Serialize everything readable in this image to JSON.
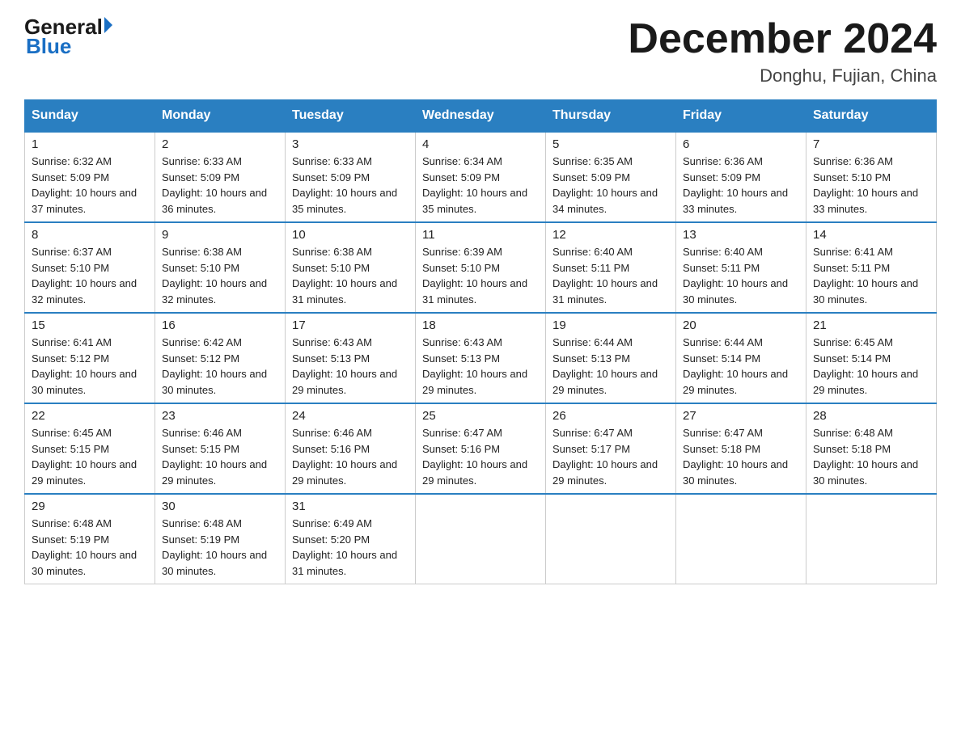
{
  "logo": {
    "general": "General",
    "triangle": "▶",
    "blue": "Blue"
  },
  "title": "December 2024",
  "location": "Donghu, Fujian, China",
  "days_of_week": [
    "Sunday",
    "Monday",
    "Tuesday",
    "Wednesday",
    "Thursday",
    "Friday",
    "Saturday"
  ],
  "weeks": [
    [
      {
        "day": "1",
        "sunrise": "Sunrise: 6:32 AM",
        "sunset": "Sunset: 5:09 PM",
        "daylight": "Daylight: 10 hours and 37 minutes."
      },
      {
        "day": "2",
        "sunrise": "Sunrise: 6:33 AM",
        "sunset": "Sunset: 5:09 PM",
        "daylight": "Daylight: 10 hours and 36 minutes."
      },
      {
        "day": "3",
        "sunrise": "Sunrise: 6:33 AM",
        "sunset": "Sunset: 5:09 PM",
        "daylight": "Daylight: 10 hours and 35 minutes."
      },
      {
        "day": "4",
        "sunrise": "Sunrise: 6:34 AM",
        "sunset": "Sunset: 5:09 PM",
        "daylight": "Daylight: 10 hours and 35 minutes."
      },
      {
        "day": "5",
        "sunrise": "Sunrise: 6:35 AM",
        "sunset": "Sunset: 5:09 PM",
        "daylight": "Daylight: 10 hours and 34 minutes."
      },
      {
        "day": "6",
        "sunrise": "Sunrise: 6:36 AM",
        "sunset": "Sunset: 5:09 PM",
        "daylight": "Daylight: 10 hours and 33 minutes."
      },
      {
        "day": "7",
        "sunrise": "Sunrise: 6:36 AM",
        "sunset": "Sunset: 5:10 PM",
        "daylight": "Daylight: 10 hours and 33 minutes."
      }
    ],
    [
      {
        "day": "8",
        "sunrise": "Sunrise: 6:37 AM",
        "sunset": "Sunset: 5:10 PM",
        "daylight": "Daylight: 10 hours and 32 minutes."
      },
      {
        "day": "9",
        "sunrise": "Sunrise: 6:38 AM",
        "sunset": "Sunset: 5:10 PM",
        "daylight": "Daylight: 10 hours and 32 minutes."
      },
      {
        "day": "10",
        "sunrise": "Sunrise: 6:38 AM",
        "sunset": "Sunset: 5:10 PM",
        "daylight": "Daylight: 10 hours and 31 minutes."
      },
      {
        "day": "11",
        "sunrise": "Sunrise: 6:39 AM",
        "sunset": "Sunset: 5:10 PM",
        "daylight": "Daylight: 10 hours and 31 minutes."
      },
      {
        "day": "12",
        "sunrise": "Sunrise: 6:40 AM",
        "sunset": "Sunset: 5:11 PM",
        "daylight": "Daylight: 10 hours and 31 minutes."
      },
      {
        "day": "13",
        "sunrise": "Sunrise: 6:40 AM",
        "sunset": "Sunset: 5:11 PM",
        "daylight": "Daylight: 10 hours and 30 minutes."
      },
      {
        "day": "14",
        "sunrise": "Sunrise: 6:41 AM",
        "sunset": "Sunset: 5:11 PM",
        "daylight": "Daylight: 10 hours and 30 minutes."
      }
    ],
    [
      {
        "day": "15",
        "sunrise": "Sunrise: 6:41 AM",
        "sunset": "Sunset: 5:12 PM",
        "daylight": "Daylight: 10 hours and 30 minutes."
      },
      {
        "day": "16",
        "sunrise": "Sunrise: 6:42 AM",
        "sunset": "Sunset: 5:12 PM",
        "daylight": "Daylight: 10 hours and 30 minutes."
      },
      {
        "day": "17",
        "sunrise": "Sunrise: 6:43 AM",
        "sunset": "Sunset: 5:13 PM",
        "daylight": "Daylight: 10 hours and 29 minutes."
      },
      {
        "day": "18",
        "sunrise": "Sunrise: 6:43 AM",
        "sunset": "Sunset: 5:13 PM",
        "daylight": "Daylight: 10 hours and 29 minutes."
      },
      {
        "day": "19",
        "sunrise": "Sunrise: 6:44 AM",
        "sunset": "Sunset: 5:13 PM",
        "daylight": "Daylight: 10 hours and 29 minutes."
      },
      {
        "day": "20",
        "sunrise": "Sunrise: 6:44 AM",
        "sunset": "Sunset: 5:14 PM",
        "daylight": "Daylight: 10 hours and 29 minutes."
      },
      {
        "day": "21",
        "sunrise": "Sunrise: 6:45 AM",
        "sunset": "Sunset: 5:14 PM",
        "daylight": "Daylight: 10 hours and 29 minutes."
      }
    ],
    [
      {
        "day": "22",
        "sunrise": "Sunrise: 6:45 AM",
        "sunset": "Sunset: 5:15 PM",
        "daylight": "Daylight: 10 hours and 29 minutes."
      },
      {
        "day": "23",
        "sunrise": "Sunrise: 6:46 AM",
        "sunset": "Sunset: 5:15 PM",
        "daylight": "Daylight: 10 hours and 29 minutes."
      },
      {
        "day": "24",
        "sunrise": "Sunrise: 6:46 AM",
        "sunset": "Sunset: 5:16 PM",
        "daylight": "Daylight: 10 hours and 29 minutes."
      },
      {
        "day": "25",
        "sunrise": "Sunrise: 6:47 AM",
        "sunset": "Sunset: 5:16 PM",
        "daylight": "Daylight: 10 hours and 29 minutes."
      },
      {
        "day": "26",
        "sunrise": "Sunrise: 6:47 AM",
        "sunset": "Sunset: 5:17 PM",
        "daylight": "Daylight: 10 hours and 29 minutes."
      },
      {
        "day": "27",
        "sunrise": "Sunrise: 6:47 AM",
        "sunset": "Sunset: 5:18 PM",
        "daylight": "Daylight: 10 hours and 30 minutes."
      },
      {
        "day": "28",
        "sunrise": "Sunrise: 6:48 AM",
        "sunset": "Sunset: 5:18 PM",
        "daylight": "Daylight: 10 hours and 30 minutes."
      }
    ],
    [
      {
        "day": "29",
        "sunrise": "Sunrise: 6:48 AM",
        "sunset": "Sunset: 5:19 PM",
        "daylight": "Daylight: 10 hours and 30 minutes."
      },
      {
        "day": "30",
        "sunrise": "Sunrise: 6:48 AM",
        "sunset": "Sunset: 5:19 PM",
        "daylight": "Daylight: 10 hours and 30 minutes."
      },
      {
        "day": "31",
        "sunrise": "Sunrise: 6:49 AM",
        "sunset": "Sunset: 5:20 PM",
        "daylight": "Daylight: 10 hours and 31 minutes."
      },
      null,
      null,
      null,
      null
    ]
  ]
}
